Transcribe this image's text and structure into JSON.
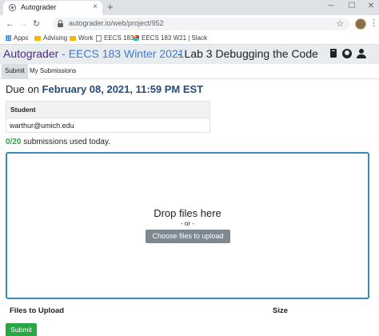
{
  "browser": {
    "tab_title": "Autograder",
    "tab_close": "×",
    "new_tab": "+",
    "url": "autograder.io/web/project/952",
    "window_controls": [
      "─",
      "☐",
      "✕"
    ],
    "bookmarks": [
      {
        "label": "Apps",
        "icon": "apps-grid-icon"
      },
      {
        "label": "Advising",
        "icon": "folder-icon"
      },
      {
        "label": "Work",
        "icon": "folder-icon"
      },
      {
        "label": "EECS 183",
        "icon": "page-icon"
      },
      {
        "label": "EECS 183 W21 | Slack",
        "icon": "slack-icon"
      }
    ]
  },
  "header": {
    "brand": "Autograder",
    "course": " - EECS 183 Winter 2021",
    "project": "- Lab 3 Debugging the Code"
  },
  "tabs": [
    "Submit",
    "My Submissions"
  ],
  "due": {
    "prefix": "Due on ",
    "date": "February 08, 2021, 11:59 PM EST"
  },
  "student_table": {
    "header": "Student",
    "rows": [
      "warthur@umich.edu"
    ]
  },
  "submissions": {
    "count": "0/20",
    "text": " submissions used today."
  },
  "dropzone": {
    "title": "Drop files here",
    "or": "- or -",
    "button": "Choose files to upload"
  },
  "upload_table": {
    "files_header": "Files to Upload",
    "size_header": "Size"
  },
  "submit_button": "Submit",
  "colors": {
    "brand": "#4b2b86",
    "course": "#3a7bd5",
    "success": "#28a745",
    "dropzone_border": "#3a88b5"
  }
}
